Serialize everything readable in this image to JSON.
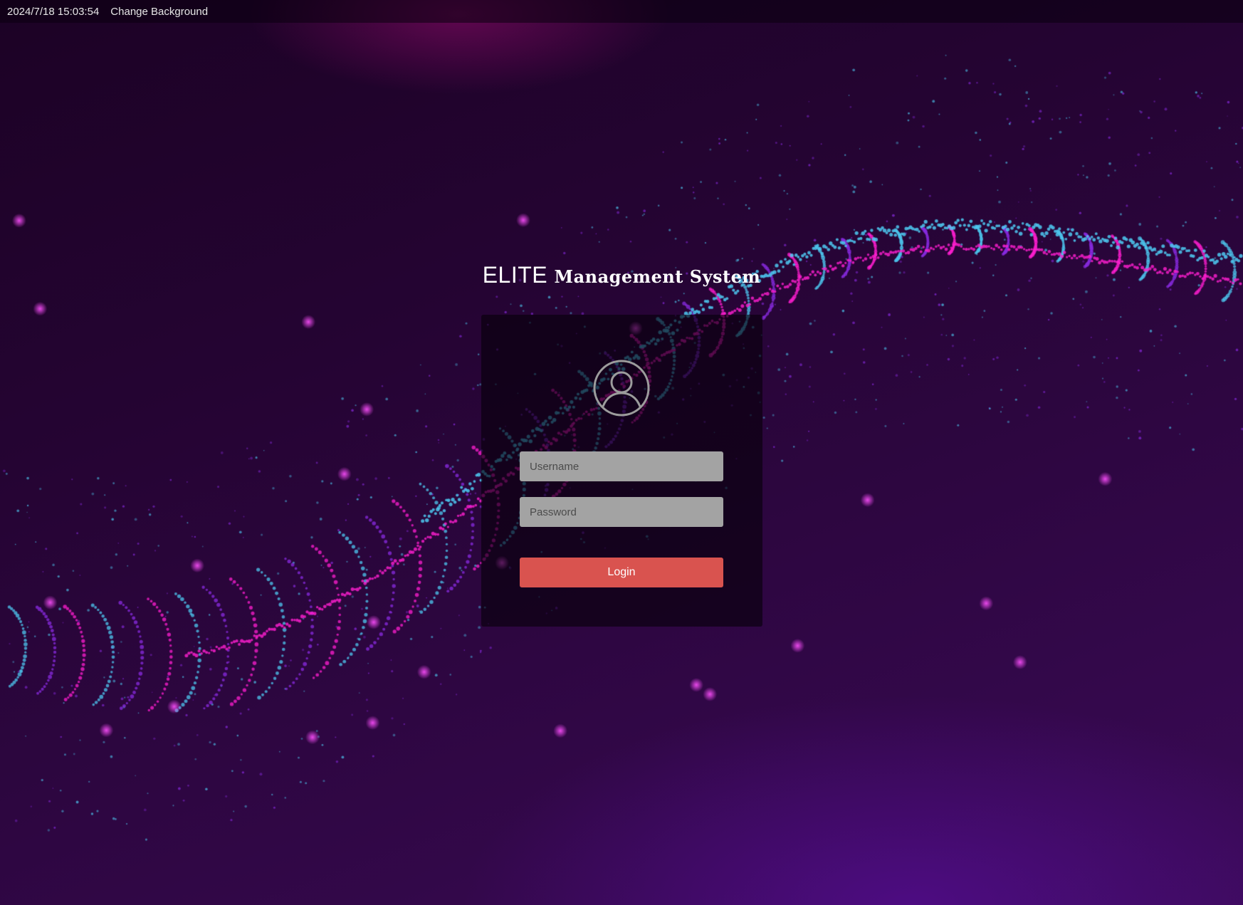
{
  "topbar": {
    "datetime": "2024/7/18 15:03:54",
    "change_background_label": "Change Background"
  },
  "login_page": {
    "title_brand": "ELITE",
    "title_rest": "Management System",
    "avatar_icon": "user-circle-icon",
    "username_placeholder": "Username",
    "username_value": "",
    "password_placeholder": "Password",
    "password_value": "",
    "login_button_label": "Login"
  },
  "colors": {
    "background": "#250433",
    "panel": "#06000a",
    "input_background": "#a3a3a3",
    "login_button": "#d9534f",
    "particle_cyan": "#4ec8f0",
    "particle_violet": "#8a2be2",
    "particle_magenta": "#ff1fd0"
  }
}
